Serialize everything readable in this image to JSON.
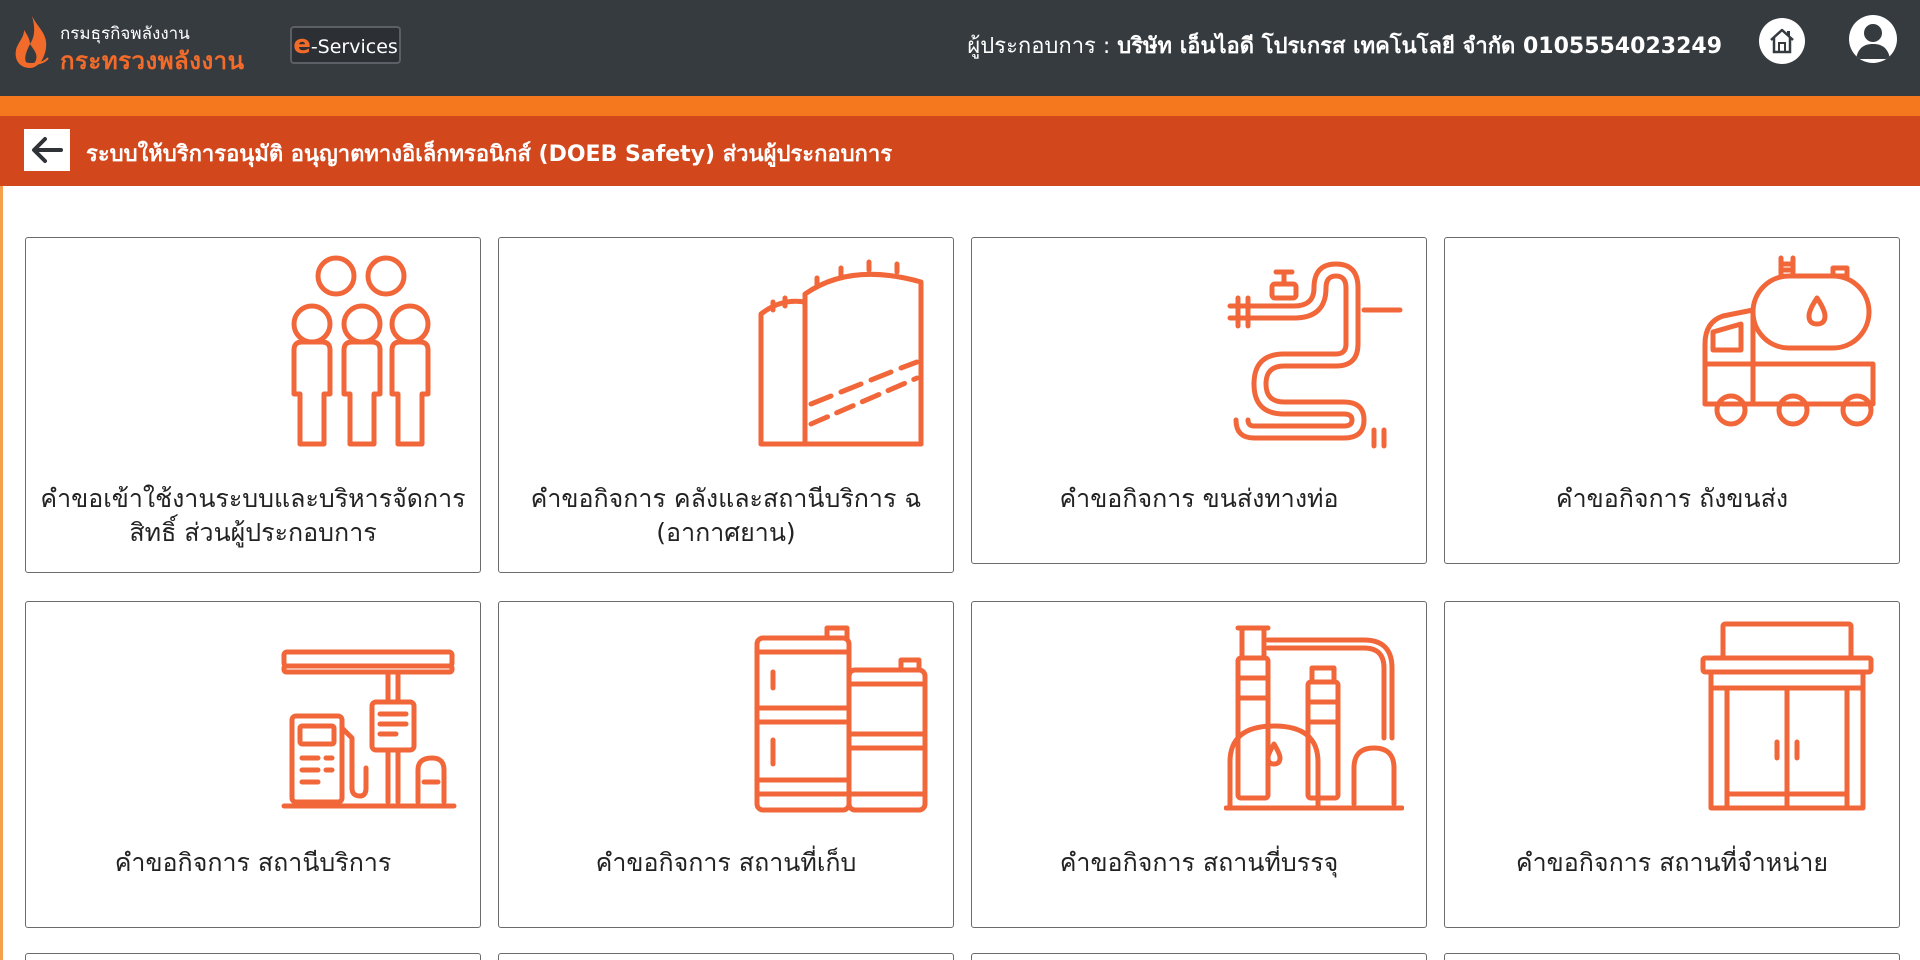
{
  "header": {
    "logo_line1": "กรมธุรกิจพลังงาน",
    "logo_line2": "กระทรวงพลังงาน",
    "eservices_e": "e",
    "eservices_rest": "-Services",
    "operator_label": "ผู้ประกอบการ : ",
    "operator_company": "บริษัท เอ็นไอดี โปรเกรส เทคโนโลยี จำกัด 0105554023249"
  },
  "titlebar": {
    "title": "ระบบให้บริการอนุมัติ อนุญาตทางอิเล็กทรอนิกส์ (DOEB Safety) ส่วนผู้ประกอบการ"
  },
  "cards": [
    {
      "label": "คำขอเข้าใช้งานระบบและบริหารจัดการสิทธิ์ ส่วนผู้ประกอบการ",
      "icon": "people-group-icon"
    },
    {
      "label": "คำขอกิจการ คลังและสถานีบริการ ฉ (อากาศยาน)",
      "icon": "storage-tanks-icon"
    },
    {
      "label": "คำขอกิจการ ขนส่งทางท่อ",
      "icon": "pipeline-icon"
    },
    {
      "label": "คำขอกิจการ ถังขนส่ง",
      "icon": "tanker-truck-icon"
    },
    {
      "label": "คำขอกิจการ สถานีบริการ",
      "icon": "fuel-station-icon"
    },
    {
      "label": "คำขอกิจการ สถานที่เก็บ",
      "icon": "oil-barrels-icon"
    },
    {
      "label": "คำขอกิจการ สถานที่บรรจุ",
      "icon": "refinery-plant-icon"
    },
    {
      "label": "คำขอกิจการ สถานที่จำหน่าย",
      "icon": "shop-building-icon"
    }
  ],
  "colors": {
    "header_bg": "#363b40",
    "accent_strip": "#f5781e",
    "titlebar_bg": "#d2471c",
    "icon_orange": "#f2673a"
  }
}
